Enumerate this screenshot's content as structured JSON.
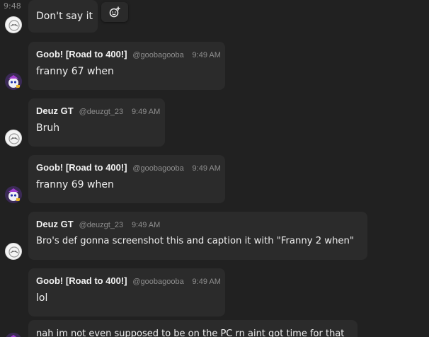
{
  "first_message": {
    "time": "9:48",
    "text": "Don't say it"
  },
  "messages": [
    {
      "name": "Goob! [Road to 400!]",
      "handle": "@goobagooba",
      "time": "9:49 AM",
      "text": "franny 67 when",
      "avatar": "cartoon-avatar"
    },
    {
      "name": "Deuz GT",
      "handle": "@deuzgt_23",
      "time": "9:49 AM",
      "text": "Bruh",
      "avatar": "white-avatar"
    },
    {
      "name": "Goob! [Road to 400!]",
      "handle": "@goobagooba",
      "time": "9:49 AM",
      "text": "franny 69 when",
      "avatar": "cartoon-avatar"
    },
    {
      "name": "Deuz GT",
      "handle": "@deuzgt_23",
      "time": "9:49 AM",
      "text": "Bro's def gonna screenshot this and caption it with \"Franny 2 when\"",
      "avatar": "white-avatar"
    },
    {
      "name": "Goob! [Road to 400!]",
      "handle": "@goobagooba",
      "time": "9:49 AM",
      "text": "lol",
      "avatar": "cartoon-avatar"
    },
    {
      "text": "nah im not even supposed to be on the PC rn aint got time for that",
      "avatar": "cartoon-avatar"
    }
  ],
  "icons": {
    "add_reaction": "add-reaction-icon"
  },
  "colors": {
    "background": "#212121",
    "bubble": "#2b2b2b",
    "text": "#eeeeee",
    "muted": "#8e8e8e"
  }
}
